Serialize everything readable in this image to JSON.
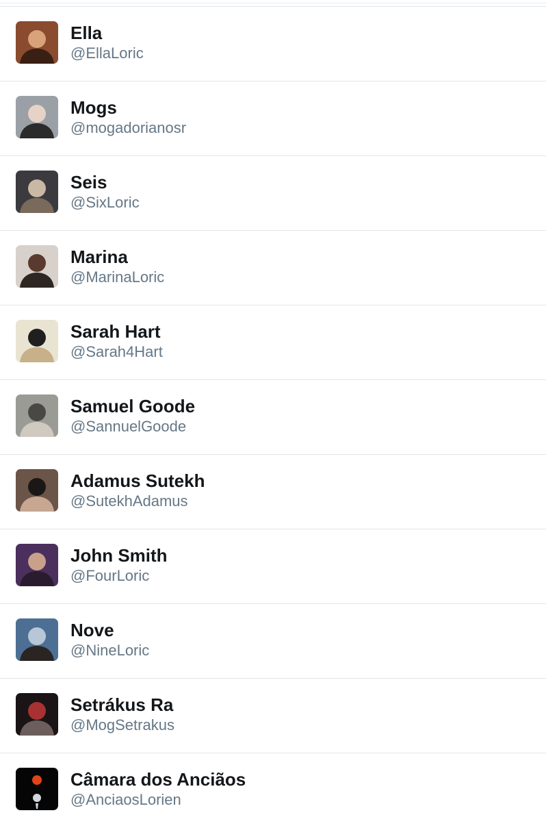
{
  "users": [
    {
      "name": "Ella",
      "handle": "@EllaLoric",
      "avatar_icon": "avatar-photo",
      "colors": [
        "#8a4b2f",
        "#d9a27a",
        "#3a1f14"
      ]
    },
    {
      "name": "Mogs",
      "handle": "@mogadorianosr",
      "avatar_icon": "avatar-photo",
      "colors": [
        "#9aa0a6",
        "#e6d2c6",
        "#2b2b2b"
      ]
    },
    {
      "name": "Seis",
      "handle": "@SixLoric",
      "avatar_icon": "avatar-photo",
      "colors": [
        "#3b3b3f",
        "#c9b8a3",
        "#7a6a5c"
      ]
    },
    {
      "name": "Marina",
      "handle": "@MarinaLoric",
      "avatar_icon": "avatar-photo",
      "colors": [
        "#d8d0ca",
        "#5a3a2e",
        "#2d2623"
      ]
    },
    {
      "name": "Sarah Hart",
      "handle": "@Sarah4Hart",
      "avatar_icon": "avatar-photo",
      "colors": [
        "#e9e4d2",
        "#1f1f1f",
        "#c8b089"
      ]
    },
    {
      "name": "Samuel Goode",
      "handle": "@SannuelGoode",
      "avatar_icon": "avatar-photo",
      "colors": [
        "#9b9b95",
        "#4a4844",
        "#cfc9bf"
      ]
    },
    {
      "name": "Adamus Sutekh",
      "handle": "@SutekhAdamus",
      "avatar_icon": "avatar-photo",
      "colors": [
        "#6b5448",
        "#1b1716",
        "#c7a792"
      ]
    },
    {
      "name": "John Smith",
      "handle": "@FourLoric",
      "avatar_icon": "avatar-photo",
      "colors": [
        "#4b2f5c",
        "#c9a08a",
        "#2a1c2e"
      ]
    },
    {
      "name": "Nove",
      "handle": "@NineLoric",
      "avatar_icon": "avatar-photo",
      "colors": [
        "#4d6f94",
        "#b8c7d8",
        "#2a2522"
      ]
    },
    {
      "name": "Setrákus Ra",
      "handle": "@MogSetrakus",
      "avatar_icon": "avatar-photo",
      "colors": [
        "#1a1416",
        "#a83232",
        "#6b5e5c"
      ]
    },
    {
      "name": "Câmara dos Anciãos",
      "handle": "@AnciaosLorien",
      "avatar_icon": "avatar-emblem",
      "colors": [
        "#050505",
        "#e0431a",
        "#cfd6dc"
      ]
    }
  ]
}
